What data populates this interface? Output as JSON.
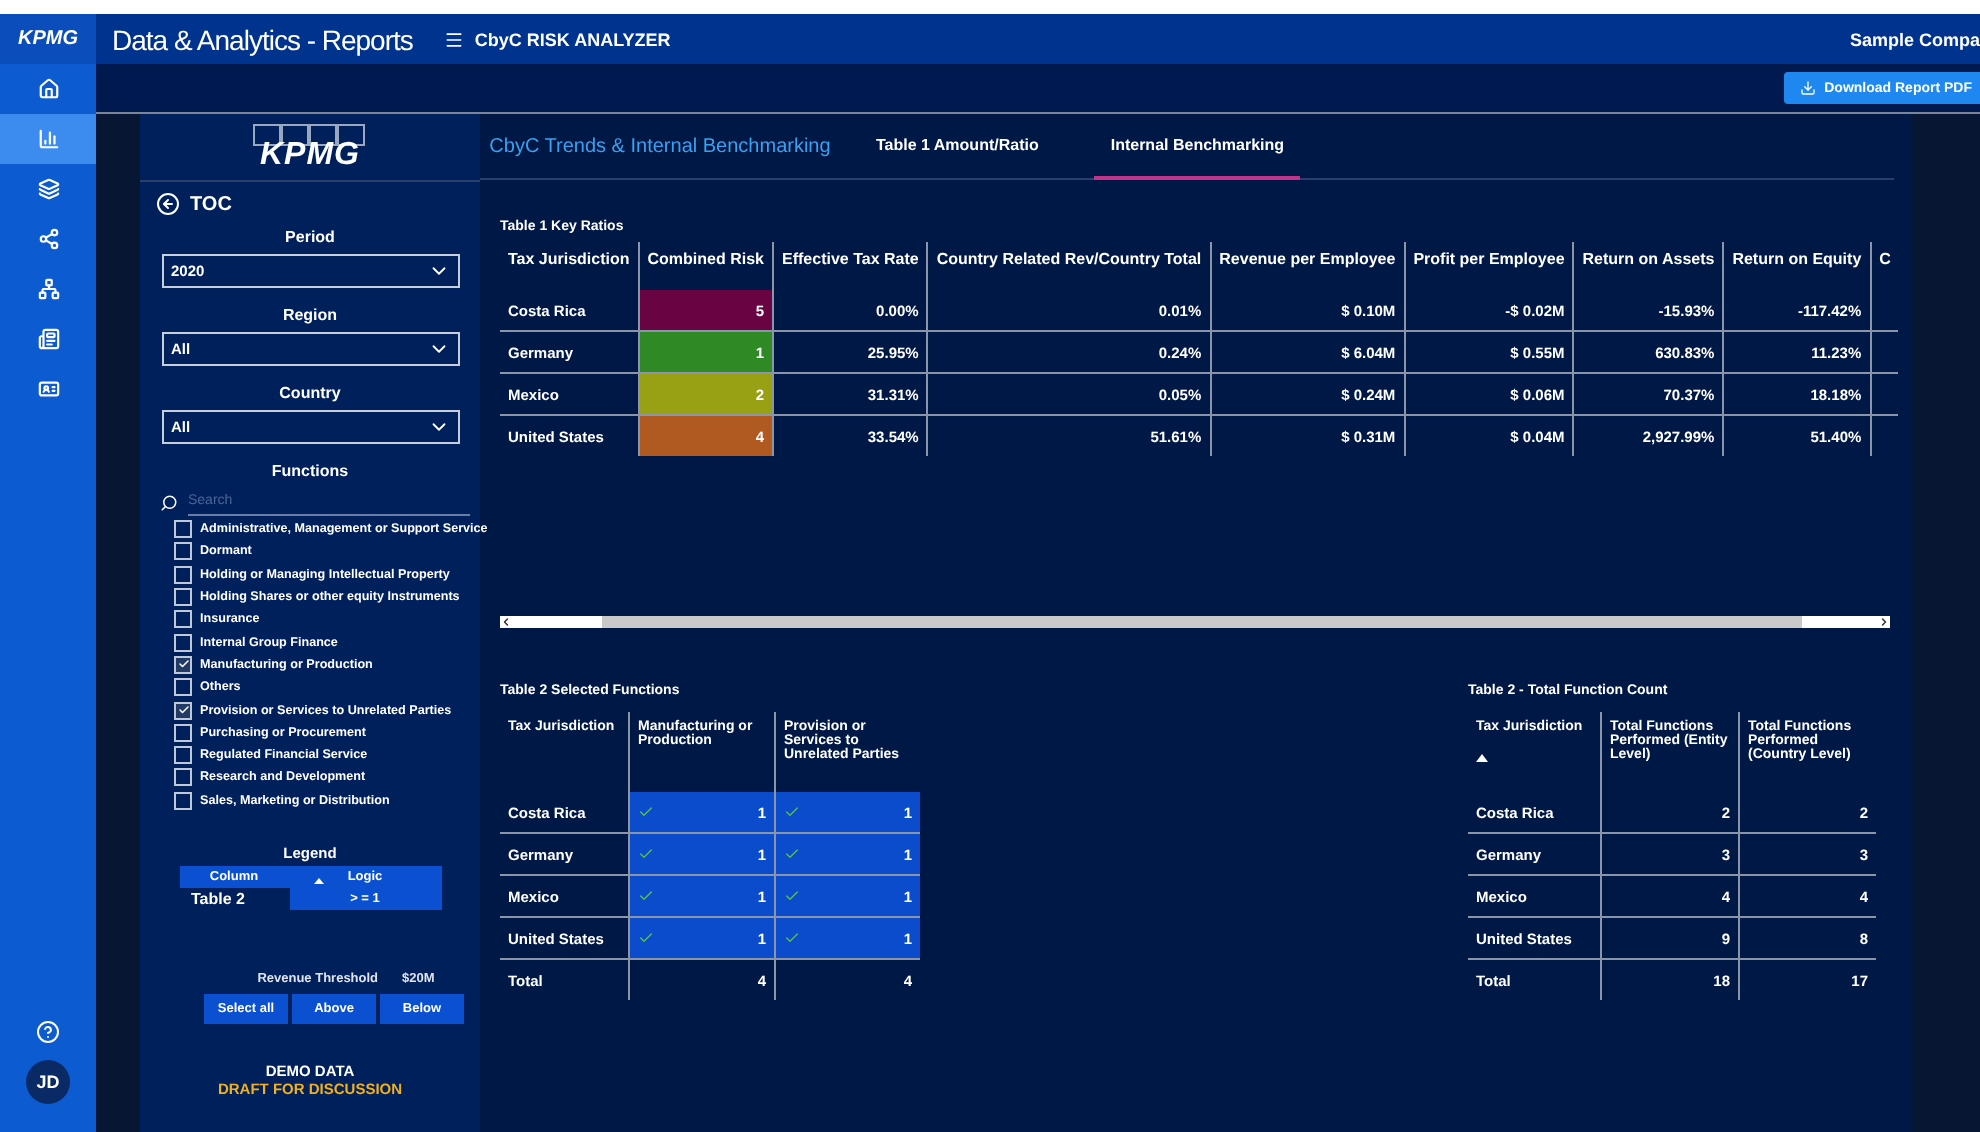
{
  "app": {
    "logo": "KPMG",
    "title": "Data & Analytics - Reports",
    "report_name": "CbyC RISK ANALYZER",
    "company": "Sample Compa",
    "download_button": "Download Report PDF"
  },
  "nav": {
    "items": [
      {
        "kind": "home",
        "selected": false
      },
      {
        "kind": "chart",
        "selected": true
      },
      {
        "kind": "layers",
        "selected": false
      },
      {
        "kind": "share",
        "selected": false
      },
      {
        "kind": "hierarchy",
        "selected": false
      },
      {
        "kind": "news",
        "selected": false
      },
      {
        "kind": "card",
        "selected": false
      }
    ],
    "avatar": "JD"
  },
  "report": {
    "logo": "KPMG",
    "page_title": "CbyC Trends & Internal Benchmarking",
    "tabs": [
      {
        "label": "Table 1 Amount/Ratio",
        "selected": false
      },
      {
        "label": "Internal Benchmarking",
        "selected": true
      }
    ]
  },
  "sidebar": {
    "back_link": "TOC",
    "filters": [
      {
        "label": "Period",
        "value": "2020"
      },
      {
        "label": "Region",
        "value": "All"
      },
      {
        "label": "Country",
        "value": "All"
      }
    ],
    "functions": {
      "title": "Functions",
      "placeholder": "Search",
      "items": [
        {
          "label": "Administrative, Management or Support Service",
          "checked": false
        },
        {
          "label": "Dormant",
          "checked": false
        },
        {
          "label": "Holding or Managing Intellectual Property",
          "checked": false
        },
        {
          "label": "Holding Shares or other equity Instruments",
          "checked": false
        },
        {
          "label": "Insurance",
          "checked": false
        },
        {
          "label": "Internal Group Finance",
          "checked": false
        },
        {
          "label": "Manufacturing or Production",
          "checked": true
        },
        {
          "label": "Others",
          "checked": false
        },
        {
          "label": "Provision or Services to Unrelated Parties",
          "checked": true
        },
        {
          "label": "Purchasing or Procurement",
          "checked": false
        },
        {
          "label": "Regulated Financial Service",
          "checked": false
        },
        {
          "label": "Research and Development",
          "checked": false
        },
        {
          "label": "Sales, Marketing or Distribution",
          "checked": false
        }
      ]
    },
    "legend": {
      "title": "Legend",
      "columns": [
        "Column",
        "Logic"
      ],
      "row": [
        "Table 2",
        "> = 1"
      ]
    },
    "threshold": {
      "label": "Revenue Threshold",
      "value": "$20M",
      "buttons": [
        "Select all",
        "Above",
        "Below"
      ]
    },
    "notice": [
      "DEMO DATA",
      "DRAFT FOR DISCUSSION"
    ]
  },
  "table1": {
    "title": "Table 1 Key Ratios",
    "columns": [
      "Tax Jurisdiction",
      "Combined Risk",
      "Effective Tax Rate",
      "Country Related Rev/Country Total",
      "Revenue per Employee",
      "Profit per Employee",
      "Return on Assets",
      "Return on Equity",
      "C"
    ],
    "rows": [
      {
        "jurisdiction": "Costa Rica",
        "risk": {
          "value": "5",
          "color": "#6a0341"
        },
        "values": [
          "0.00%",
          "0.01%",
          "$ 0.10M",
          "-$ 0.02M",
          "-15.93%",
          "-117.42%"
        ]
      },
      {
        "jurisdiction": "Germany",
        "risk": {
          "value": "1",
          "color": "#2f8a25"
        },
        "values": [
          "25.95%",
          "0.24%",
          "$ 6.04M",
          "$ 0.55M",
          "630.83%",
          "11.23%"
        ]
      },
      {
        "jurisdiction": "Mexico",
        "risk": {
          "value": "2",
          "color": "#98a014"
        },
        "values": [
          "31.31%",
          "0.05%",
          "$ 0.24M",
          "$ 0.06M",
          "70.37%",
          "18.18%"
        ]
      },
      {
        "jurisdiction": "United States",
        "risk": {
          "value": "4",
          "color": "#b05a22"
        },
        "values": [
          "33.54%",
          "51.61%",
          "$ 0.31M",
          "$ 0.04M",
          "2,927.99%",
          "51.40%"
        ]
      }
    ]
  },
  "table2": {
    "title": "Table 2 Selected Functions",
    "columns": [
      "Tax Jurisdiction",
      "Manufacturing or Production",
      "Provision or Services to Unrelated Parties"
    ],
    "rows": [
      {
        "jurisdiction": "Costa Rica",
        "values": [
          {
            "value": "1",
            "checked": true
          },
          {
            "value": "1",
            "checked": true
          }
        ]
      },
      {
        "jurisdiction": "Germany",
        "values": [
          {
            "value": "1",
            "checked": true
          },
          {
            "value": "1",
            "checked": true
          }
        ]
      },
      {
        "jurisdiction": "Mexico",
        "values": [
          {
            "value": "1",
            "checked": true
          },
          {
            "value": "1",
            "checked": true
          }
        ]
      },
      {
        "jurisdiction": "United States",
        "values": [
          {
            "value": "1",
            "checked": true
          },
          {
            "value": "1",
            "checked": true
          }
        ]
      }
    ],
    "total": [
      "Total",
      "4",
      "4"
    ]
  },
  "table3": {
    "title": "Table 2 - Total Function Count",
    "columns": [
      "Tax Jurisdiction",
      "Total Functions Performed (Entity Level)",
      "Total Functions Performed (Country Level)"
    ],
    "rows": [
      [
        "Costa Rica",
        "2",
        "2"
      ],
      [
        "Germany",
        "3",
        "3"
      ],
      [
        "Mexico",
        "4",
        "4"
      ],
      [
        "United States",
        "9",
        "8"
      ]
    ],
    "total": [
      "Total",
      "18",
      "17"
    ]
  }
}
